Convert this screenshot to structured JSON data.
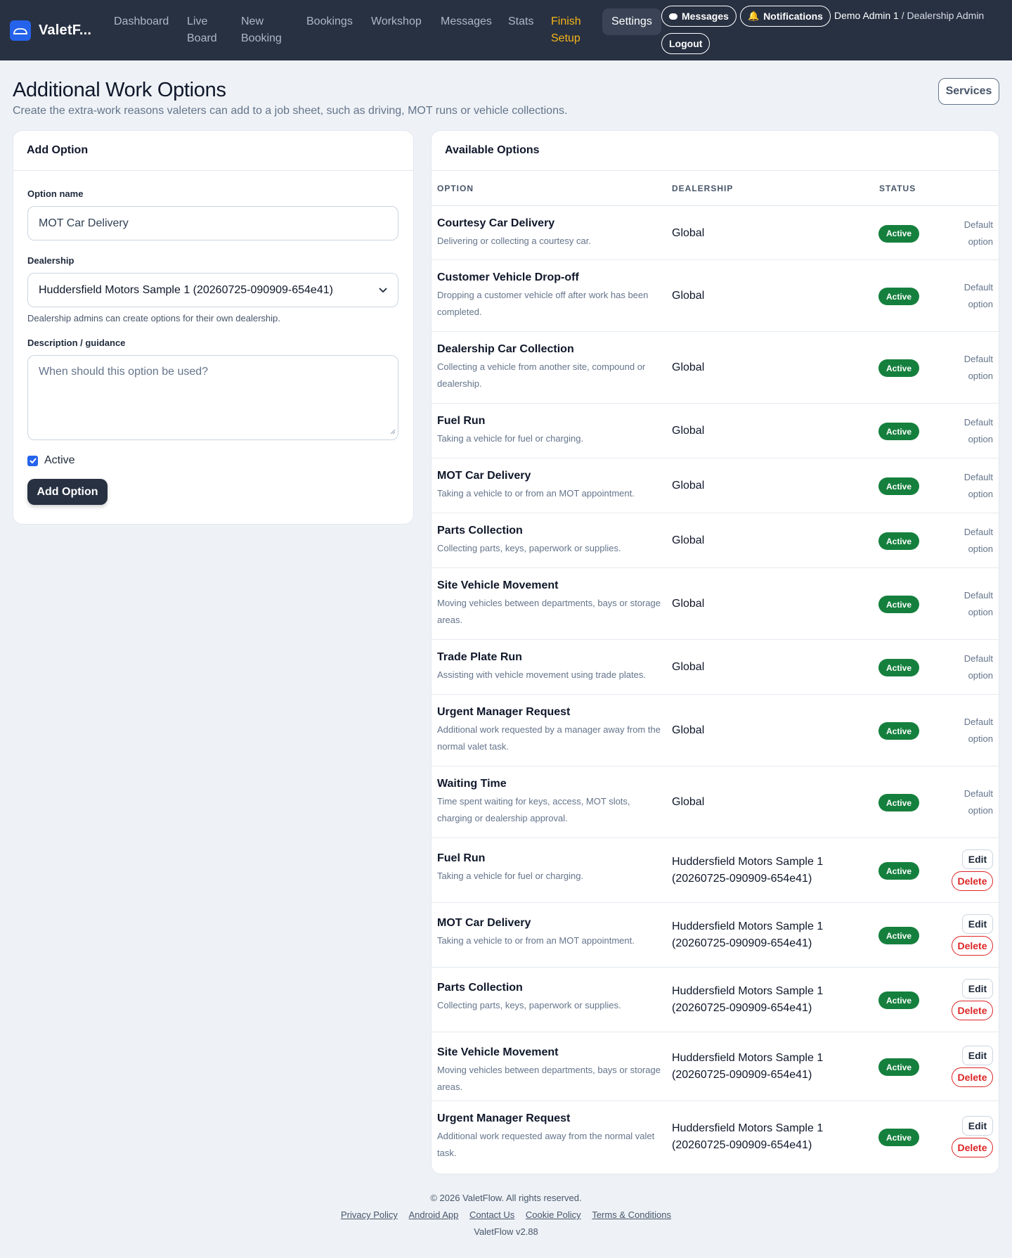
{
  "nav": {
    "brand": "ValetF...",
    "links": [
      {
        "label": "Dashboard"
      },
      {
        "label": "Live Board"
      },
      {
        "label": "New Booking"
      },
      {
        "label": "Bookings"
      },
      {
        "label": "Workshop"
      },
      {
        "label": "Messages"
      },
      {
        "label": "Stats"
      },
      {
        "label": "Finish Setup"
      },
      {
        "label": "Settings"
      }
    ],
    "messages_pill": "Messages",
    "notifications_pill": "Notifications",
    "logout": "Logout",
    "user_name": "Demo Admin 1",
    "user_role": "/ Dealership Admin"
  },
  "header": {
    "title": "Additional Work Options",
    "subtitle": "Create the extra-work reasons valeters can add to a job sheet, such as driving, MOT runs or vehicle collections.",
    "services_button": "Services"
  },
  "form": {
    "title": "Add Option",
    "name_label": "Option name",
    "name_value": "MOT Car Delivery",
    "dealership_label": "Dealership",
    "dealership_value": "Huddersfield Motors Sample 1 (20260725-090909-654e41)",
    "dealership_hint": "Dealership admins can create options for their own dealership.",
    "description_label": "Description / guidance",
    "description_placeholder": "When should this option be used?",
    "active_label": "Active",
    "active_checked": true,
    "submit_label": "Add Option"
  },
  "table": {
    "title": "Available Options",
    "columns": {
      "option": "OPTION",
      "dealership": "DEALERSHIP",
      "status": "STATUS"
    },
    "default_note_line1": "Default",
    "default_note_line2": "option",
    "edit_label": "Edit",
    "delete_label": "Delete",
    "rows": [
      {
        "name": "Courtesy Car Delivery",
        "desc": "Delivering or collecting a courtesy car.",
        "dealership": "Global",
        "status": "Active",
        "default": true
      },
      {
        "name": "Customer Vehicle Drop-off",
        "desc": "Dropping a customer vehicle off after work has been completed.",
        "dealership": "Global",
        "status": "Active",
        "default": true
      },
      {
        "name": "Dealership Car Collection",
        "desc": "Collecting a vehicle from another site, compound or dealership.",
        "dealership": "Global",
        "status": "Active",
        "default": true
      },
      {
        "name": "Fuel Run",
        "desc": "Taking a vehicle for fuel or charging.",
        "dealership": "Global",
        "status": "Active",
        "default": true
      },
      {
        "name": "MOT Car Delivery",
        "desc": "Taking a vehicle to or from an MOT appointment.",
        "dealership": "Global",
        "status": "Active",
        "default": true
      },
      {
        "name": "Parts Collection",
        "desc": "Collecting parts, keys, paperwork or supplies.",
        "dealership": "Global",
        "status": "Active",
        "default": true
      },
      {
        "name": "Site Vehicle Movement",
        "desc": "Moving vehicles between departments, bays or storage areas.",
        "dealership": "Global",
        "status": "Active",
        "default": true
      },
      {
        "name": "Trade Plate Run",
        "desc": "Assisting with vehicle movement using trade plates.",
        "dealership": "Global",
        "status": "Active",
        "default": true
      },
      {
        "name": "Urgent Manager Request",
        "desc": "Additional work requested by a manager away from the normal valet task.",
        "dealership": "Global",
        "status": "Active",
        "default": true
      },
      {
        "name": "Waiting Time",
        "desc": "Time spent waiting for keys, access, MOT slots, charging or dealership approval.",
        "dealership": "Global",
        "status": "Active",
        "default": true
      },
      {
        "name": "Fuel Run",
        "desc": "Taking a vehicle for fuel or charging.",
        "dealership": "Huddersfield Motors Sample 1 (20260725-090909-654e41)",
        "status": "Active",
        "default": false
      },
      {
        "name": "MOT Car Delivery",
        "desc": "Taking a vehicle to or from an MOT appointment.",
        "dealership": "Huddersfield Motors Sample 1 (20260725-090909-654e41)",
        "status": "Active",
        "default": false
      },
      {
        "name": "Parts Collection",
        "desc": "Collecting parts, keys, paperwork or supplies.",
        "dealership": "Huddersfield Motors Sample 1 (20260725-090909-654e41)",
        "status": "Active",
        "default": false
      },
      {
        "name": "Site Vehicle Movement",
        "desc": "Moving vehicles between departments, bays or storage areas.",
        "dealership": "Huddersfield Motors Sample 1 (20260725-090909-654e41)",
        "status": "Active",
        "default": false
      },
      {
        "name": "Urgent Manager Request",
        "desc": "Additional work requested away from the normal valet task.",
        "dealership": "Huddersfield Motors Sample 1 (20260725-090909-654e41)",
        "status": "Active",
        "default": false
      }
    ]
  },
  "footer": {
    "copyright": "© 2026 ValetFlow. All rights reserved.",
    "links": [
      "Privacy Policy",
      "Android App",
      "Contact Us",
      "Cookie Policy",
      "Terms & Conditions"
    ],
    "version": "ValetFlow v2.88"
  },
  "colors": {
    "nav_bg": "#283142",
    "accent": "#2563eb",
    "warning": "#f5b517",
    "active_badge": "#15803d",
    "delete": "#dc2626"
  }
}
